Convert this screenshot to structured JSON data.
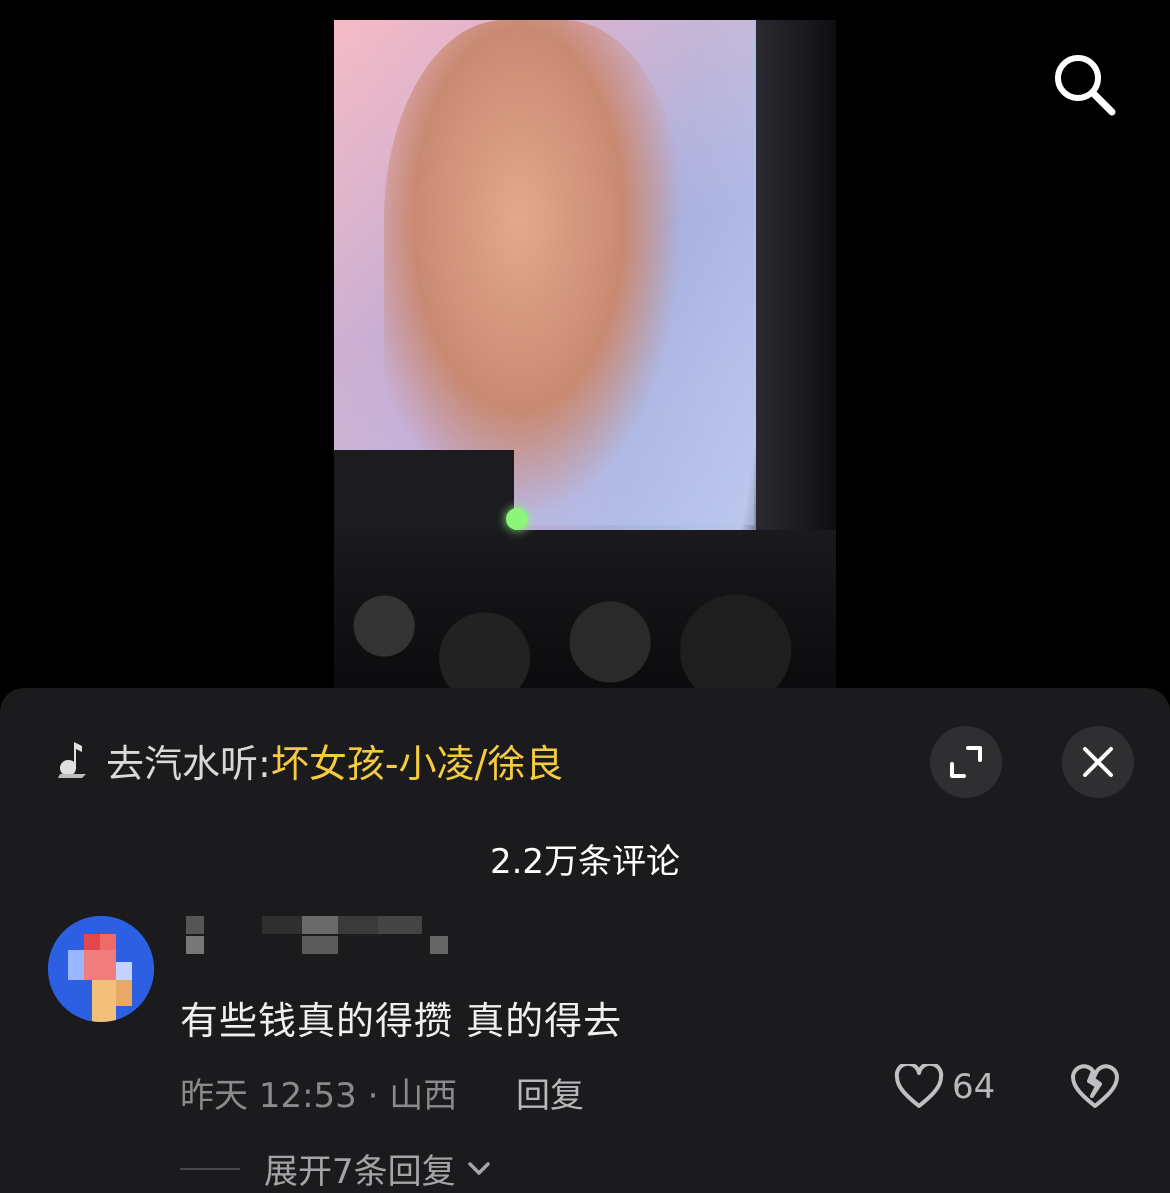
{
  "icons": {
    "search": "search-icon",
    "music": "music-note-icon",
    "expand": "expand-icon",
    "close": "close-icon",
    "like": "heart-icon",
    "dislike": "broken-heart-icon",
    "chevron": "chevron-down-icon"
  },
  "colors": {
    "song_title": "#f5cc3f",
    "sheet_bg": "#1b1b1d",
    "button_bg": "#2f2f31"
  },
  "music_bar": {
    "prefix": "去汽水听:",
    "song": "坏女孩-小凌/徐良"
  },
  "comments_header": {
    "count_label": "2.2万条评论"
  },
  "comment": {
    "text": "有些钱真的得攒 真的得去",
    "meta": "昨天 12:53 · 山西",
    "reply_label": "回复",
    "likes": "64",
    "expand_label": "展开7条回复"
  }
}
